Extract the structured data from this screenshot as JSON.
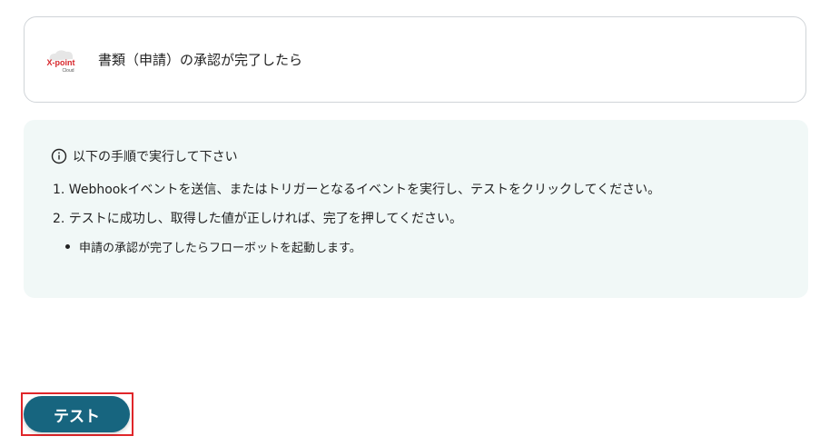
{
  "trigger": {
    "app_logo_text": "X-point",
    "app_logo_sub": "Cloud",
    "title": "書類（申請）の承認が完了したら"
  },
  "instructions": {
    "title": "以下の手順で実行して下さい",
    "steps": [
      "1. Webhookイベントを送信、またはトリガーとなるイベントを実行し、テストをクリックしてください。",
      "2. テストに成功し、取得した値が正しければ、完了を押してください。"
    ],
    "bullets": [
      "申請の承認が完了したらフローボットを起動します。"
    ]
  },
  "actions": {
    "test_label": "テスト"
  },
  "colors": {
    "accent": "#17657f",
    "info_bg": "#f1f8f7",
    "highlight": "#e0262a",
    "logo_red": "#d7262b"
  },
  "icons": {
    "app_logo": "xpoint-cloud-logo",
    "info": "info-circle-icon"
  }
}
